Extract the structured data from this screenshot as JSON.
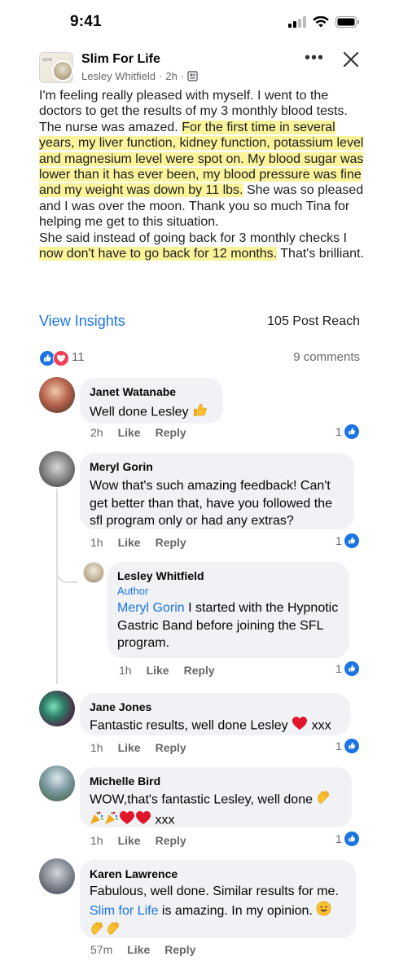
{
  "status_bar": {
    "time": "9:41"
  },
  "post": {
    "group_name": "Slim For Life",
    "group_avatar_text": "SLIM",
    "author": "Lesley Whitfield",
    "time": "2h",
    "body": {
      "p1_plain": "I'm feeling really pleased with myself. I went to the doctors to get the results of  my 3 monthly blood tests. The nurse was amazed. ",
      "p1_highlight": "For the first time in several years, my liver function, kidney function, potassium level and magnesium level were spot on. My blood sugar was lower than it has ever been, my blood pressure was fine and my weight was down by 11 lbs.",
      "p1_after": " She was so pleased and I was over the moon. Thank you so much Tina for helping me get to this situation.",
      "p2_plain": "She said instead of going back for 3 monthly checks I ",
      "p2_highlight": "now don't have to go back for 12 months.",
      "p2_after": " That's brilliant."
    },
    "view_insights": "View Insights",
    "post_reach": "105 Post Reach",
    "reaction_count": "11",
    "comments_count": "9 comments"
  },
  "comments": [
    {
      "name": "Janet Watanabe",
      "text": "Well done Lesley",
      "time": "2h",
      "like": "Like",
      "reply": "Reply",
      "likes": "1"
    },
    {
      "name": "Meryl Gorin",
      "text": "Wow that's such amazing feedback! Can't get better than that, have you followed the sfl program only or had any extras?",
      "time": "1h",
      "like": "Like",
      "reply": "Reply",
      "likes": "1"
    },
    {
      "name": "Lesley Whitfield",
      "badge": "Author",
      "mention": "Meryl Gorin",
      "text": " I started with the Hypnotic Gastric Band before joining the SFL program.",
      "time": "1h",
      "like": "Like",
      "reply": "Reply",
      "likes": "1"
    },
    {
      "name": "Jane Jones",
      "text": "Fantastic results, well done Lesley",
      "text_after": " xxx",
      "time": "1h",
      "like": "Like",
      "reply": "Reply",
      "likes": "1"
    },
    {
      "name": "Michelle Bird",
      "text": "WOW,that's fantastic Lesley, well done",
      "text_after": " xxx",
      "time": "1h",
      "like": "Like",
      "reply": "Reply",
      "likes": "1"
    },
    {
      "name": "Karen Lawrence",
      "text": "Fabulous, well done. Similar results for me. ",
      "link": "Slim for Life",
      "text_after": " is amazing. In my opinion.",
      "time": "57m",
      "like": "Like",
      "reply": "Reply"
    }
  ],
  "colors": {
    "link": "#1b74e4",
    "highlight": "#fbf49a",
    "bubble": "#f0f2f5",
    "meta": "#65676b"
  },
  "icons": [
    "signal-icon",
    "wifi-icon",
    "battery-icon",
    "more-icon",
    "close-icon",
    "like-reaction-icon",
    "love-reaction-icon",
    "thumbs-up-emoji",
    "heart-emoji",
    "clap-emoji",
    "party-emoji",
    "smile-emoji"
  ]
}
